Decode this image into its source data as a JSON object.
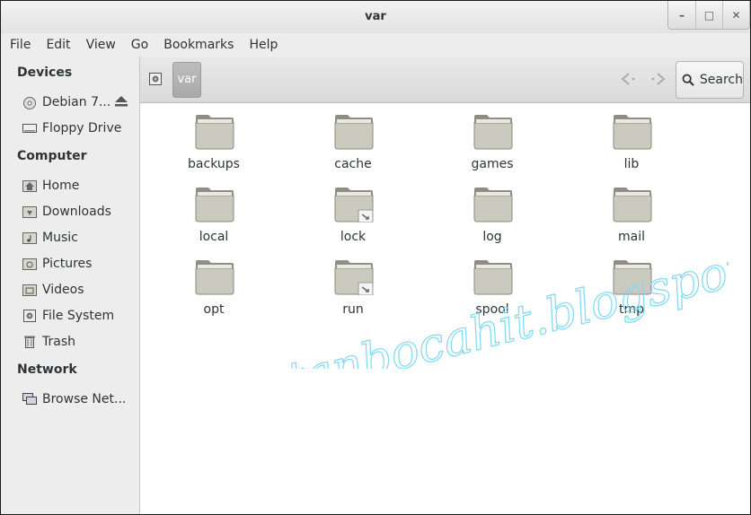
{
  "window": {
    "title": "var"
  },
  "menubar": {
    "items": [
      "File",
      "Edit",
      "View",
      "Go",
      "Bookmarks",
      "Help"
    ]
  },
  "sidebar": {
    "sections": [
      {
        "title": "Devices",
        "items": [
          {
            "label": "Debian 7...",
            "icon": "disc-icon"
          },
          {
            "label": "Floppy Drive",
            "icon": "floppy-icon"
          }
        ]
      },
      {
        "title": "Computer",
        "items": [
          {
            "label": "Home",
            "icon": "home-icon"
          },
          {
            "label": "Downloads",
            "icon": "downloads-icon"
          },
          {
            "label": "Music",
            "icon": "music-icon"
          },
          {
            "label": "Pictures",
            "icon": "pictures-icon"
          },
          {
            "label": "Videos",
            "icon": "videos-icon"
          },
          {
            "label": "File System",
            "icon": "filesystem-icon"
          },
          {
            "label": "Trash",
            "icon": "trash-icon"
          }
        ]
      },
      {
        "title": "Network",
        "items": [
          {
            "label": "Browse Net...",
            "icon": "network-icon"
          }
        ]
      }
    ]
  },
  "toolbar": {
    "breadcrumb": "var",
    "search_label": "Search"
  },
  "files": [
    {
      "name": "backups",
      "link": false
    },
    {
      "name": "cache",
      "link": false
    },
    {
      "name": "games",
      "link": false
    },
    {
      "name": "lib",
      "link": false
    },
    {
      "name": "local",
      "link": false
    },
    {
      "name": "lock",
      "link": true
    },
    {
      "name": "log",
      "link": false
    },
    {
      "name": "mail",
      "link": false
    },
    {
      "name": "opt",
      "link": false
    },
    {
      "name": "run",
      "link": true
    },
    {
      "name": "spool",
      "link": false
    },
    {
      "name": "tmp",
      "link": false
    }
  ],
  "watermark": "coretanbocahit.blogspot.com",
  "colors": {
    "watermark": "#a8e8f8",
    "folder": "#c9c8bb",
    "selected_crumb": "#b3b3b3"
  }
}
